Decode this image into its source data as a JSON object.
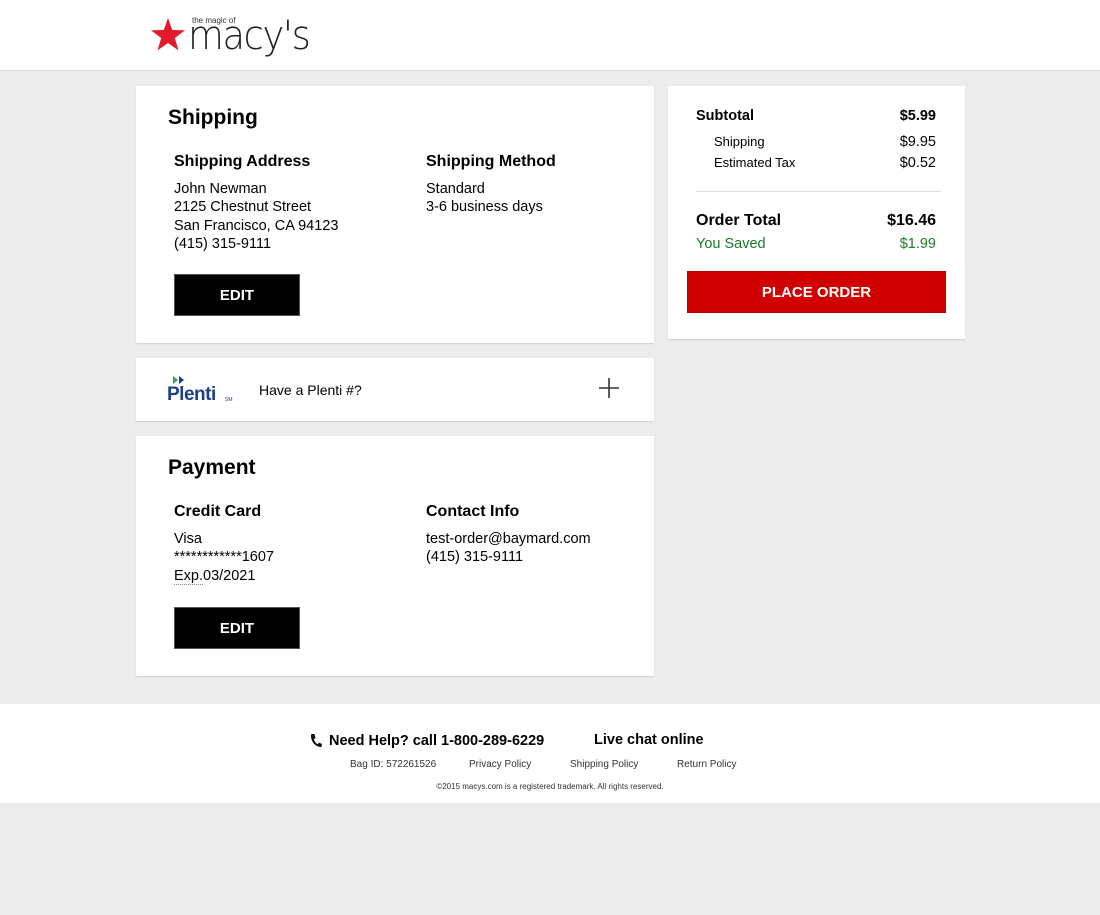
{
  "header": {
    "logo_tagline": "the magic of",
    "logo_word": "macy's",
    "star_color": "#e21a2c"
  },
  "shipping": {
    "title": "Shipping",
    "address_heading": "Shipping Address",
    "address_lines": [
      "John Newman",
      "2125 Chestnut Street",
      "San Francisco, CA 94123",
      "(415) 315-9111"
    ],
    "method_heading": "Shipping Method",
    "method_lines": [
      "Standard",
      "3-6 business days"
    ],
    "edit_label": "EDIT"
  },
  "plenti": {
    "logo_text": "Plenti",
    "logo_sm": "SM",
    "prompt": "Have a Plenti #?",
    "expand_icon": "plus-icon"
  },
  "payment": {
    "title": "Payment",
    "card_heading": "Credit Card",
    "card_type": "Visa",
    "card_number": "************1607",
    "exp_label": "Exp.",
    "exp_value": "03/2021",
    "contact_heading": "Contact Info",
    "contact_lines": [
      "test-order@baymard.com",
      "(415) 315-9111"
    ],
    "edit_label": "EDIT"
  },
  "summary": {
    "subtotal_label": "Subtotal",
    "subtotal_value": "$5.99",
    "shipping_label": "Shipping",
    "shipping_value": "$9.95",
    "tax_label": "Estimated Tax",
    "tax_value": "$0.52",
    "total_label": "Order Total",
    "total_value": "$16.46",
    "saved_label": "You Saved",
    "saved_value": "$1.99",
    "place_order_label": "PLACE ORDER",
    "accent_color": "#d10000",
    "saved_color": "#1a7a2a"
  },
  "footer": {
    "help_text": "Need Help? call 1-800-289-6229",
    "help_icon": "phone-icon",
    "chat_text": "Live chat online",
    "bag_id": "Bag ID: 572261526",
    "links": [
      "Privacy Policy",
      "Shipping Policy",
      "Return Policy"
    ],
    "copyright": "©2015 macys.com is a registered trademark. All rights reserved."
  }
}
